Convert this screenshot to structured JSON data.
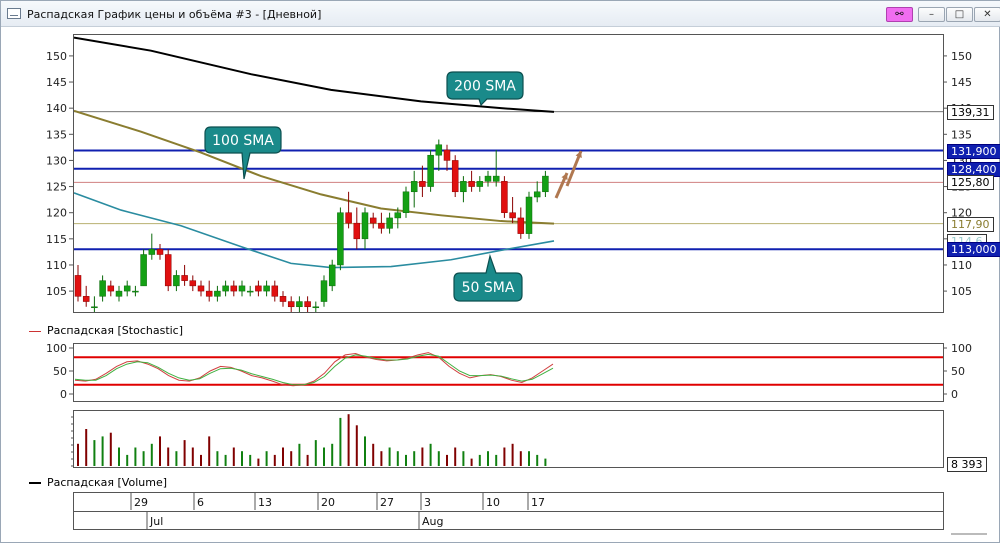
{
  "window": {
    "title": "Распадская График цены и объёма #3 - [Дневной]",
    "buttons": {
      "link": "⚯",
      "minimize": "–",
      "maximize": "□",
      "close": "✕"
    }
  },
  "main_pane": {
    "y_ticks": [
      150,
      145,
      140,
      135,
      130,
      125,
      120,
      115,
      110,
      105
    ],
    "price_labels": [
      {
        "text": "139,31",
        "value": 139.31,
        "style": "plain"
      },
      {
        "text": "131,900",
        "value": 131.9,
        "style": "blue"
      },
      {
        "text": "128,400",
        "value": 128.4,
        "style": "blue"
      },
      {
        "text": "125,80",
        "value": 125.8,
        "style": "plain"
      },
      {
        "text": "117,90",
        "value": 117.9,
        "style": "olive"
      },
      {
        "text": "114,6",
        "value": 114.6,
        "style": "faint"
      },
      {
        "text": "113,000",
        "value": 113.0,
        "style": "blue"
      }
    ],
    "annotations": {
      "sma200": "200 SMA",
      "sma100": "100 SMA",
      "sma50": "50 SMA"
    }
  },
  "stochastic": {
    "legend": "Распадская [Stochastic]",
    "y_ticks": [
      100,
      50,
      0
    ]
  },
  "volume": {
    "legend": "Распадская [Volume]",
    "last_value": "8 393"
  },
  "date_axis": {
    "days": [
      "29",
      "6",
      "13",
      "20",
      "27",
      "3",
      "10",
      "17"
    ],
    "months": [
      "Jul",
      "Aug"
    ]
  },
  "chart_data": [
    {
      "type": "candlestick",
      "title": "Распадская",
      "ylim": [
        101,
        154
      ],
      "series": [
        {
          "name": "OHLC",
          "candles": [
            [
              108,
              110,
              103,
              104
            ],
            [
              104,
              106,
              102,
              103
            ],
            [
              102,
              104,
              101,
              102
            ],
            [
              104,
              108,
              103,
              107
            ],
            [
              106,
              107,
              104,
              105
            ],
            [
              104,
              106,
              103,
              105
            ],
            [
              105,
              107,
              104,
              106
            ],
            [
              105,
              106,
              104,
              105
            ],
            [
              106,
              113,
              106,
              112
            ],
            [
              112,
              116,
              111,
              113
            ],
            [
              113,
              114,
              111,
              112
            ],
            [
              112,
              113,
              105,
              106
            ],
            [
              106,
              109,
              105,
              108
            ],
            [
              108,
              110,
              106,
              107
            ],
            [
              107,
              108,
              105,
              106
            ],
            [
              106,
              107,
              104,
              105
            ],
            [
              105,
              107,
              103,
              104
            ],
            [
              104,
              106,
              103,
              105
            ],
            [
              105,
              107,
              104,
              106
            ],
            [
              106,
              107,
              104,
              105
            ],
            [
              105,
              107,
              104,
              106
            ],
            [
              105,
              106,
              104,
              105
            ],
            [
              106,
              107,
              104,
              105
            ],
            [
              105,
              107,
              104,
              106
            ],
            [
              106,
              107,
              103,
              104
            ],
            [
              104,
              105,
              102,
              103
            ],
            [
              103,
              104,
              101,
              102
            ],
            [
              102,
              104,
              101,
              103
            ],
            [
              103,
              104,
              101,
              102
            ],
            [
              102,
              103,
              101,
              102
            ],
            [
              103,
              108,
              102,
              107
            ],
            [
              106,
              111,
              105,
              110
            ],
            [
              110,
              121,
              109,
              120
            ],
            [
              120,
              124,
              117,
              118
            ],
            [
              118,
              121,
              113,
              115
            ],
            [
              115,
              121,
              113,
              120
            ],
            [
              119,
              120,
              117,
              118
            ],
            [
              118,
              120,
              116,
              117
            ],
            [
              117,
              120,
              116,
              119
            ],
            [
              119,
              121,
              117,
              120
            ],
            [
              120,
              125,
              119,
              124
            ],
            [
              124,
              128,
              121,
              126
            ],
            [
              126,
              129,
              123,
              125
            ],
            [
              125,
              132,
              124,
              131
            ],
            [
              131,
              134,
              128,
              133
            ],
            [
              132,
              133,
              128,
              130
            ],
            [
              130,
              131,
              123,
              124
            ],
            [
              124,
              127,
              122,
              126
            ],
            [
              126,
              128,
              124,
              125
            ],
            [
              125,
              127,
              124,
              126
            ],
            [
              126,
              128,
              125,
              127
            ],
            [
              126,
              132,
              125,
              127
            ],
            [
              126,
              127,
              119,
              120
            ],
            [
              120,
              123,
              118,
              119
            ],
            [
              119,
              121,
              115,
              116
            ],
            [
              116,
              124,
              115,
              123
            ],
            [
              123,
              126,
              122,
              124
            ],
            [
              124,
              128,
              123,
              127
            ]
          ]
        },
        {
          "name": "200 SMA",
          "values": [
            153.5,
            139.3
          ]
        },
        {
          "name": "100 SMA",
          "values": [
            139.5,
            117.9
          ]
        },
        {
          "name": "50 SMA",
          "values": [
            123.8,
            114.6
          ]
        }
      ],
      "horizontal_levels": [
        131.9,
        128.4,
        125.8,
        117.9,
        113.0
      ]
    },
    {
      "type": "line",
      "title": "Распадская [Stochastic]",
      "ylim": [
        0,
        100
      ],
      "levels": [
        80,
        20
      ],
      "series": [
        {
          "name": "%K",
          "values": [
            30,
            28,
            32,
            45,
            60,
            70,
            72,
            65,
            55,
            40,
            30,
            28,
            35,
            50,
            60,
            58,
            50,
            40,
            35,
            28,
            20,
            18,
            20,
            28,
            45,
            70,
            85,
            88,
            80,
            75,
            72,
            74,
            78,
            85,
            90,
            80,
            60,
            45,
            35,
            40,
            42,
            38,
            30,
            25,
            35,
            50,
            65
          ]
        },
        {
          "name": "%D",
          "values": [
            32,
            30,
            30,
            40,
            55,
            65,
            70,
            68,
            58,
            45,
            35,
            30,
            33,
            45,
            55,
            56,
            52,
            44,
            38,
            32,
            25,
            20,
            20,
            25,
            38,
            60,
            78,
            85,
            82,
            77,
            74,
            74,
            76,
            82,
            86,
            82,
            66,
            50,
            40,
            40,
            41,
            39,
            33,
            28,
            32,
            44,
            56
          ]
        }
      ]
    },
    {
      "type": "bar",
      "title": "Распадская [Volume]",
      "values": [
        6,
        10,
        7,
        8,
        9,
        5,
        3,
        5,
        4,
        6,
        8,
        5,
        4,
        7,
        5,
        3,
        8,
        4,
        3,
        5,
        4,
        3,
        2,
        4,
        3,
        5,
        4,
        6,
        3,
        7,
        5,
        6,
        13,
        14,
        11,
        8,
        6,
        4,
        5,
        4,
        3,
        4,
        5,
        6,
        4,
        3,
        5,
        4,
        2,
        3,
        4,
        3,
        5,
        6,
        4,
        4,
        3,
        2
      ],
      "last_value": 8393
    }
  ]
}
